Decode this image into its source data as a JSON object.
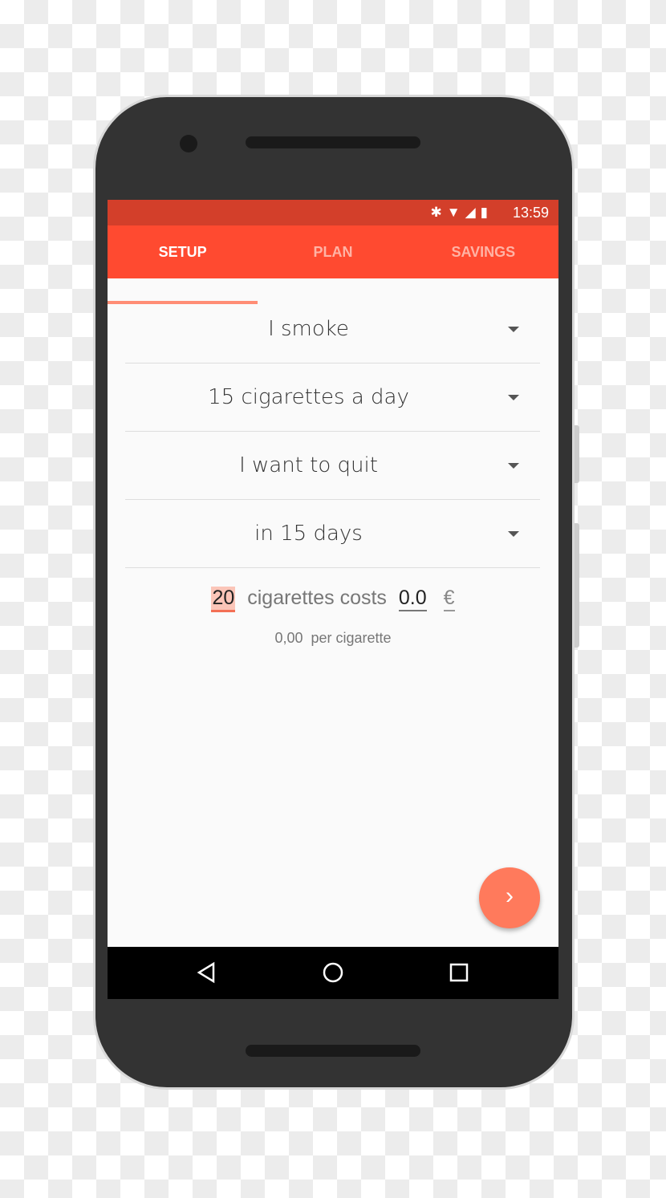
{
  "status": {
    "time": "13:59",
    "icons": [
      "bluetooth-icon",
      "wifi-icon",
      "signal-icon",
      "battery-icon"
    ]
  },
  "tabs": [
    {
      "label": "SETUP",
      "active": true
    },
    {
      "label": "PLAN"
    },
    {
      "label": "SAVINGS"
    }
  ],
  "dropdowns": [
    {
      "value": "I smoke"
    },
    {
      "value": "15 cigarettes a day"
    },
    {
      "value": "I want to quit"
    },
    {
      "value": "in 15 days"
    }
  ],
  "cost": {
    "count": "20",
    "text": "cigarettes costs",
    "price": "0.0",
    "currency": "€",
    "per_value": "0,00",
    "per_label": "per cigarette"
  },
  "colors": {
    "status_bar": "#d33f2a",
    "toolbar": "#ff4a30",
    "fab": "#ff7a5c"
  }
}
